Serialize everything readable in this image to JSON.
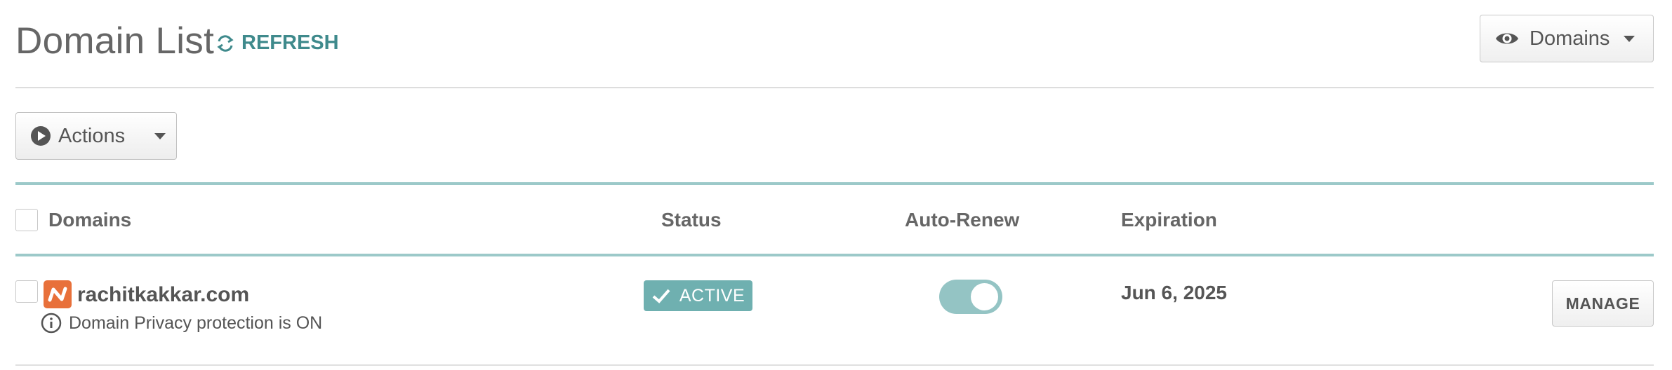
{
  "header": {
    "title": "Domain List",
    "refresh_label": "REFRESH",
    "view_button_label": "Domains"
  },
  "toolbar": {
    "actions_label": "Actions"
  },
  "table": {
    "columns": [
      "Domains",
      "Status",
      "Auto-Renew",
      "Expiration"
    ],
    "rows": [
      {
        "domain": "rachitkakkar.com",
        "privacy_note": "Domain Privacy protection is ON",
        "status": "ACTIVE",
        "auto_renew": true,
        "expiration": "Jun 6, 2025",
        "action_label": "MANAGE"
      }
    ]
  },
  "colors": {
    "accent": "#3f8a8c",
    "status_active": "#6fb0b0",
    "toggle_on": "#94c4c4",
    "favicon": "#e8703a",
    "divider": "#9cc9c9"
  },
  "icons": {
    "refresh": "refresh-icon",
    "view": "eye-icon",
    "actions": "play-circle-icon",
    "privacy": "info-icon",
    "status": "check-icon",
    "favicon": "namecheap-logo"
  }
}
